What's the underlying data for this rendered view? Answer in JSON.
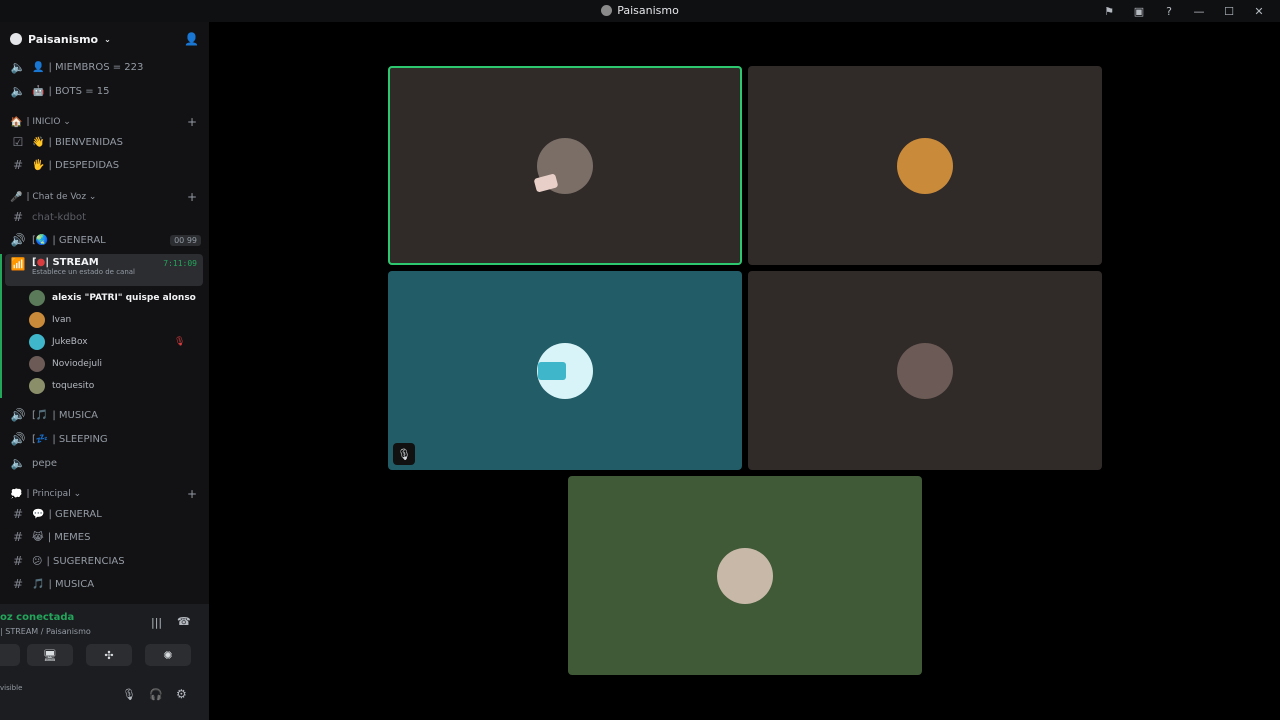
{
  "window": {
    "title": "Paisanismo"
  },
  "server": {
    "name": "Paisanismo"
  },
  "sidebar": {
    "stats": [
      {
        "label": "| MIEMBROS = 223"
      },
      {
        "label": "| BOTS = 15"
      }
    ],
    "cat_inicio": "| INICIO",
    "inicio_channels": [
      {
        "emoji": "👋",
        "label": "| BIENVENIDAS"
      },
      {
        "emoji": "🖐",
        "label": "| DESPEDIDAS"
      }
    ],
    "cat_voz": "| Chat de Voz",
    "chat_kdbot": "chat-kdbot",
    "general_voice": {
      "prefix": "[",
      "label": "| GENERAL",
      "badge_a": "00",
      "badge_b": "99"
    },
    "stream": {
      "prefix": "[",
      "label": "| STREAM",
      "timer": "7:11:09",
      "status": "Establece un estado de canal"
    },
    "users": [
      {
        "name": "alexis \"PATRI\" quispe alonso",
        "color": "#5a7a5a"
      },
      {
        "name": "Ivan",
        "color": "#c98a3a"
      },
      {
        "name": "JukeBox",
        "color": "#3fb6c9"
      },
      {
        "name": "Noviodejuli",
        "color": "#6b5a55"
      },
      {
        "name": "toquesito",
        "color": "#8a8f6a"
      }
    ],
    "voice_more": [
      {
        "prefix": "[",
        "label": "| MUSICA"
      },
      {
        "prefix": "[",
        "label": "| SLEEPING"
      },
      {
        "prefix": "",
        "label": "pepe"
      }
    ],
    "cat_principal": "| Principal",
    "principal_channels": [
      {
        "emoji": "💬",
        "label": "| GENERAL"
      },
      {
        "emoji": "😹",
        "label": "| MEMES"
      },
      {
        "emoji": "😕",
        "label": "| SUGERENCIAS"
      },
      {
        "emoji": "🎵",
        "label": "| MUSICA"
      }
    ]
  },
  "voice_panel": {
    "status": "oz conectada",
    "channel": "| STREAM / Paisanismo",
    "user_status": "visible"
  },
  "colors": {
    "accent_green": "#23a55a",
    "tile_dark": "#302a28",
    "tile_teal": "#215c67",
    "tile_olive": "#405937"
  }
}
